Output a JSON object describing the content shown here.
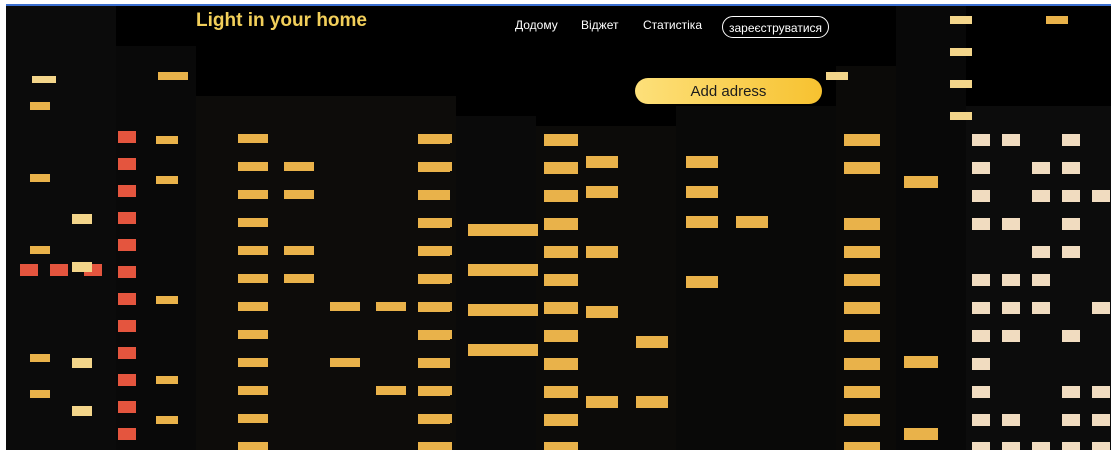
{
  "brand": {
    "title": "Light in your home"
  },
  "nav": {
    "home": "Додому",
    "widget": "Віджет",
    "stats": "Статистіка",
    "register": "зареєструватися"
  },
  "actions": {
    "add_address": "Add adress"
  },
  "colors": {
    "brand_text": "#f2cf5a",
    "button_gradient_start": "#fde07a",
    "button_gradient_end": "#f7c230",
    "window_warm": "#e9b24a",
    "window_red": "#e4553e"
  },
  "background": {
    "subject": "night city apartment buildings with lit windows"
  }
}
